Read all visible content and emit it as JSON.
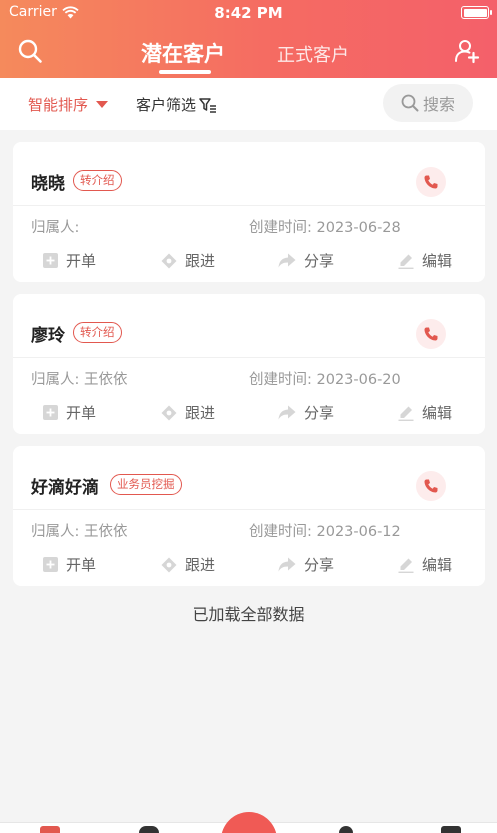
{
  "status_bar": {
    "carrier": "Carrier",
    "time": "8:42 PM"
  },
  "header": {
    "tabs": [
      {
        "label": "潜在客户",
        "active": true
      },
      {
        "label": "正式客户",
        "active": false
      }
    ],
    "left_icon": "search-icon",
    "right_icon": "add-user-icon"
  },
  "filters": {
    "sort_label": "智能排序",
    "filter_label": "客户筛选",
    "search_label": "搜索"
  },
  "actions": {
    "open": "开单",
    "follow": "跟进",
    "share": "分享",
    "edit": "编辑"
  },
  "customers": [
    {
      "name": "晓晓",
      "tag": "转介绍",
      "owner": "归属人: ",
      "created": "创建时间: 2023-06-28"
    },
    {
      "name": "廖玲",
      "tag": "转介绍",
      "owner": "归属人: 王依依",
      "created": "创建时间: 2023-06-20"
    },
    {
      "name": "好滴好滴",
      "tag": "业务员挖掘",
      "owner": "归属人: 王依依",
      "created": "创建时间: 2023-06-12"
    }
  ],
  "footer": {
    "loaded_text": "已加载全部数据"
  },
  "colors": {
    "accent": "#e2584f",
    "header_start": "#f58a5c",
    "header_end": "#f4606a"
  }
}
